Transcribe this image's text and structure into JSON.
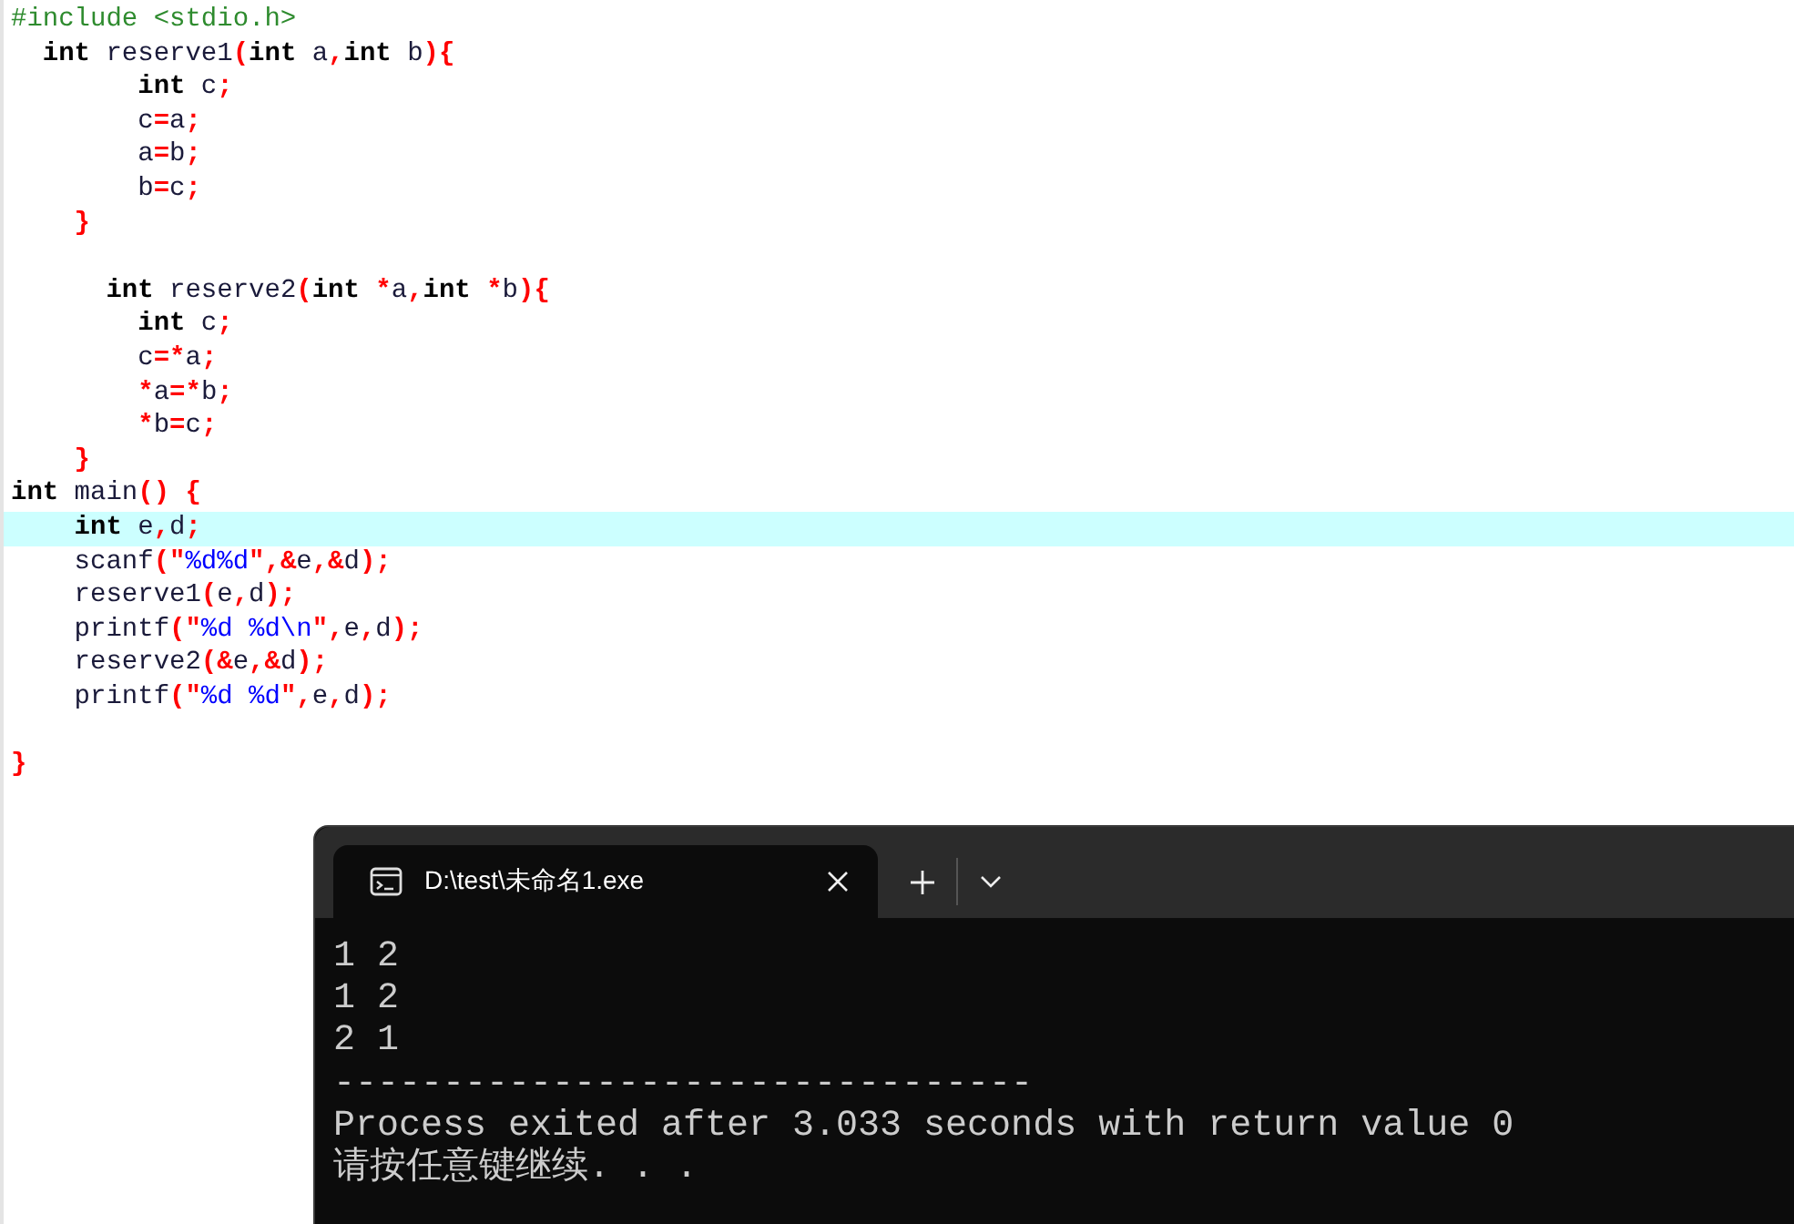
{
  "editor": {
    "lines": [
      {
        "current": false,
        "tokens": [
          {
            "kind": "pre",
            "text": "#include <stdio.h>"
          }
        ]
      },
      {
        "current": false,
        "tokens": [
          {
            "kind": "kw",
            "text": "  int"
          },
          {
            "kind": "id",
            "text": " reserve1"
          },
          {
            "kind": "sym",
            "text": "("
          },
          {
            "kind": "kw",
            "text": "int"
          },
          {
            "kind": "id",
            "text": " a"
          },
          {
            "kind": "sym",
            "text": ","
          },
          {
            "kind": "kw",
            "text": "int"
          },
          {
            "kind": "id",
            "text": " b"
          },
          {
            "kind": "sym",
            "text": "){"
          }
        ]
      },
      {
        "current": false,
        "tokens": [
          {
            "kind": "kw",
            "text": "        int"
          },
          {
            "kind": "id",
            "text": " c"
          },
          {
            "kind": "sym",
            "text": ";"
          }
        ]
      },
      {
        "current": false,
        "tokens": [
          {
            "kind": "id",
            "text": "        c"
          },
          {
            "kind": "sym",
            "text": "="
          },
          {
            "kind": "id",
            "text": "a"
          },
          {
            "kind": "sym",
            "text": ";"
          }
        ]
      },
      {
        "current": false,
        "tokens": [
          {
            "kind": "id",
            "text": "        a"
          },
          {
            "kind": "sym",
            "text": "="
          },
          {
            "kind": "id",
            "text": "b"
          },
          {
            "kind": "sym",
            "text": ";"
          }
        ]
      },
      {
        "current": false,
        "tokens": [
          {
            "kind": "id",
            "text": "        b"
          },
          {
            "kind": "sym",
            "text": "="
          },
          {
            "kind": "id",
            "text": "c"
          },
          {
            "kind": "sym",
            "text": ";"
          }
        ]
      },
      {
        "current": false,
        "tokens": [
          {
            "kind": "sym",
            "text": "    }"
          }
        ]
      },
      {
        "current": false
      },
      {
        "current": false,
        "tokens": [
          {
            "kind": "kw",
            "text": "      int"
          },
          {
            "kind": "id",
            "text": " reserve2"
          },
          {
            "kind": "sym",
            "text": "("
          },
          {
            "kind": "kw",
            "text": "int"
          },
          {
            "kind": "sym",
            "text": " *"
          },
          {
            "kind": "id",
            "text": "a"
          },
          {
            "kind": "sym",
            "text": ","
          },
          {
            "kind": "kw",
            "text": "int"
          },
          {
            "kind": "sym",
            "text": " *"
          },
          {
            "kind": "id",
            "text": "b"
          },
          {
            "kind": "sym",
            "text": "){"
          }
        ]
      },
      {
        "current": false,
        "tokens": [
          {
            "kind": "kw",
            "text": "        int"
          },
          {
            "kind": "id",
            "text": " c"
          },
          {
            "kind": "sym",
            "text": ";"
          }
        ]
      },
      {
        "current": false,
        "tokens": [
          {
            "kind": "id",
            "text": "        c"
          },
          {
            "kind": "sym",
            "text": "=*"
          },
          {
            "kind": "id",
            "text": "a"
          },
          {
            "kind": "sym",
            "text": ";"
          }
        ]
      },
      {
        "current": false,
        "tokens": [
          {
            "kind": "sym",
            "text": "        *"
          },
          {
            "kind": "id",
            "text": "a"
          },
          {
            "kind": "sym",
            "text": "=*"
          },
          {
            "kind": "id",
            "text": "b"
          },
          {
            "kind": "sym",
            "text": ";"
          }
        ]
      },
      {
        "current": false,
        "tokens": [
          {
            "kind": "sym",
            "text": "        *"
          },
          {
            "kind": "id",
            "text": "b"
          },
          {
            "kind": "sym",
            "text": "="
          },
          {
            "kind": "id",
            "text": "c"
          },
          {
            "kind": "sym",
            "text": ";"
          }
        ]
      },
      {
        "current": false,
        "tokens": [
          {
            "kind": "sym",
            "text": "    }"
          }
        ]
      },
      {
        "current": false,
        "tokens": [
          {
            "kind": "kw",
            "text": "int"
          },
          {
            "kind": "id",
            "text": " main"
          },
          {
            "kind": "sym",
            "text": "() {"
          }
        ]
      },
      {
        "current": true,
        "tokens": [
          {
            "kind": "kw",
            "text": "    int"
          },
          {
            "kind": "id",
            "text": " e"
          },
          {
            "kind": "sym",
            "text": ","
          },
          {
            "kind": "id",
            "text": "d"
          },
          {
            "kind": "sym",
            "text": ";"
          }
        ]
      },
      {
        "current": false,
        "tokens": [
          {
            "kind": "id",
            "text": "    scanf"
          },
          {
            "kind": "sym",
            "text": "(\""
          },
          {
            "kind": "str",
            "text": "%d%d"
          },
          {
            "kind": "sym",
            "text": "\",&"
          },
          {
            "kind": "id",
            "text": "e"
          },
          {
            "kind": "sym",
            "text": ",&"
          },
          {
            "kind": "id",
            "text": "d"
          },
          {
            "kind": "sym",
            "text": ");"
          }
        ]
      },
      {
        "current": false,
        "tokens": [
          {
            "kind": "id",
            "text": "    reserve1"
          },
          {
            "kind": "sym",
            "text": "("
          },
          {
            "kind": "id",
            "text": "e"
          },
          {
            "kind": "sym",
            "text": ","
          },
          {
            "kind": "id",
            "text": "d"
          },
          {
            "kind": "sym",
            "text": ");"
          }
        ]
      },
      {
        "current": false,
        "tokens": [
          {
            "kind": "id",
            "text": "    printf"
          },
          {
            "kind": "sym",
            "text": "(\""
          },
          {
            "kind": "str",
            "text": "%d %d\\n"
          },
          {
            "kind": "sym",
            "text": "\","
          },
          {
            "kind": "id",
            "text": "e"
          },
          {
            "kind": "sym",
            "text": ","
          },
          {
            "kind": "id",
            "text": "d"
          },
          {
            "kind": "sym",
            "text": ");"
          }
        ]
      },
      {
        "current": false,
        "tokens": [
          {
            "kind": "id",
            "text": "    reserve2"
          },
          {
            "kind": "sym",
            "text": "(&"
          },
          {
            "kind": "id",
            "text": "e"
          },
          {
            "kind": "sym",
            "text": ",&"
          },
          {
            "kind": "id",
            "text": "d"
          },
          {
            "kind": "sym",
            "text": ");"
          }
        ]
      },
      {
        "current": false,
        "tokens": [
          {
            "kind": "id",
            "text": "    printf"
          },
          {
            "kind": "sym",
            "text": "(\""
          },
          {
            "kind": "str",
            "text": "%d %d"
          },
          {
            "kind": "sym",
            "text": "\","
          },
          {
            "kind": "id",
            "text": "e"
          },
          {
            "kind": "sym",
            "text": ","
          },
          {
            "kind": "id",
            "text": "d"
          },
          {
            "kind": "sym",
            "text": ");"
          }
        ]
      },
      {
        "current": false
      },
      {
        "current": false,
        "tokens": [
          {
            "kind": "sym",
            "text": "}"
          }
        ]
      }
    ]
  },
  "terminal": {
    "tabs": [
      {
        "title": "D:\\test\\未命名1.exe",
        "selected": true
      }
    ],
    "output": [
      "1 2",
      "1 2",
      "2 1",
      "--------------------------------",
      "Process exited after 3.033 seconds with return value 0",
      "请按任意键继续. . ."
    ]
  }
}
